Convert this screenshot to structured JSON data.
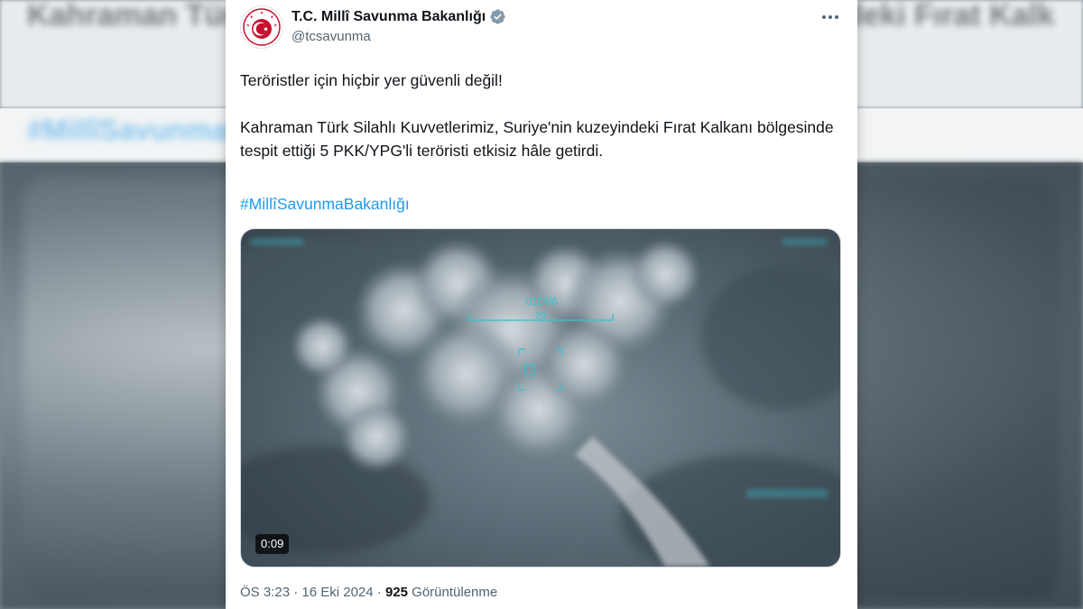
{
  "account": {
    "display_name": "T.C. Millî Savunma Bakanlığı",
    "handle": "@tcsavunma",
    "verified": true
  },
  "tweet": {
    "line1": "Teröristler için hiçbir yer güvenli değil!",
    "line2": "Kahraman Türk Silahlı Kuvvetlerimiz, Suriye'nin kuzeyindeki Fırat Kalkanı bölgesinde tespit ettiği 5 PKK/YPG'li teröristi etkisiz hâle getirdi.",
    "hashtag": "#MillîSavunmaBakanlığı"
  },
  "media": {
    "type": "video",
    "duration": "0:09",
    "hud_label": "01D06",
    "hud_sub": "20"
  },
  "meta": {
    "time": "ÖS 3:23",
    "separator": "·",
    "date": "16 Eki 2024",
    "views_count": "925",
    "views_label": "Görüntülenme"
  },
  "colors": {
    "link": "#1d9bf0",
    "verified": "#829aab",
    "text": "#0f1419",
    "muted": "#536471"
  },
  "icons": [
    "ministry-logo-icon",
    "verified-badge-icon",
    "more-options-icon"
  ]
}
